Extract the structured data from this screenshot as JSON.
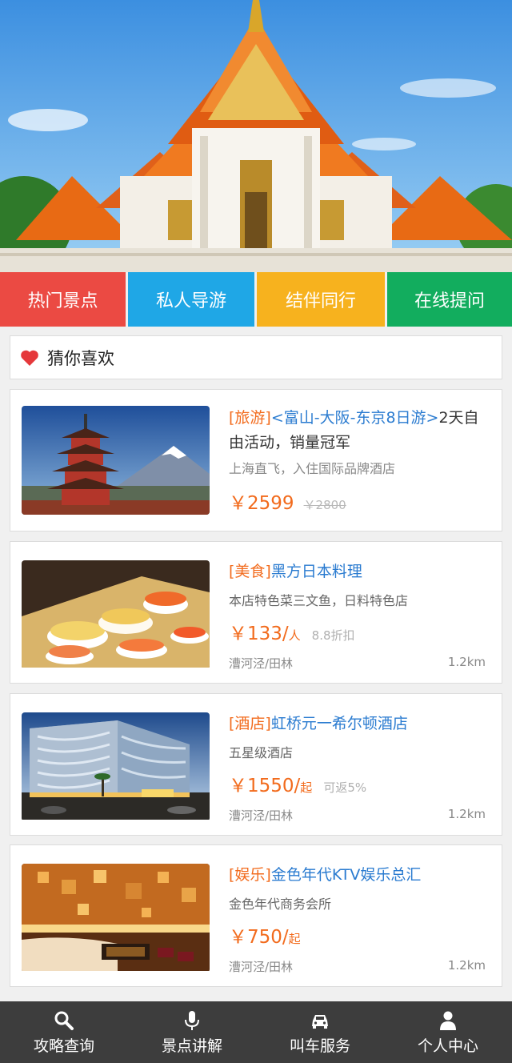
{
  "quick_nav": [
    {
      "label": "热门景点",
      "color": "#eb4a43"
    },
    {
      "label": "私人导游",
      "color": "#1fa7e6"
    },
    {
      "label": "结伴同行",
      "color": "#f7b21e"
    },
    {
      "label": "在线提问",
      "color": "#12ad5e"
    }
  ],
  "section": {
    "title": "猜你喜欢",
    "icon": "heart-icon"
  },
  "items": [
    {
      "tag": "[旅游]",
      "name": "<富山-大阪-东京8日游>",
      "name_suffix": "2天自由活动，销量冠军",
      "subtitle": "上海直飞，入住国际品牌酒店",
      "price": "￥2599",
      "old_price": "￥2800",
      "image": "mount-fuji-pagoda"
    },
    {
      "tag": "[美食]",
      "name": "黑方日本料理",
      "subtitle": "本店特色菜三文鱼，日料特色店",
      "price": "￥133/",
      "unit": "人",
      "extra": "8.8折扣",
      "location": "漕河泾/田林",
      "distance": "1.2km",
      "image": "sushi-platter"
    },
    {
      "tag": "[酒店]",
      "name": "虹桥元一希尔顿酒店",
      "subtitle": "五星级酒店",
      "price": "￥1550/",
      "unit": "起",
      "extra": "可返5%",
      "location": "漕河泾/田林",
      "distance": "1.2km",
      "image": "hotel-building"
    },
    {
      "tag": "[娱乐]",
      "name": "金色年代KTV娱乐总汇",
      "subtitle": "金色年代商务会所",
      "price": "￥750/",
      "unit": "起",
      "location": "漕河泾/田林",
      "distance": "1.2km",
      "image": "ktv-room"
    }
  ],
  "bottom_tabs": [
    {
      "label": "攻略查询",
      "icon": "search-icon"
    },
    {
      "label": "景点讲解",
      "icon": "microphone-icon"
    },
    {
      "label": "叫车服务",
      "icon": "car-icon"
    },
    {
      "label": "个人中心",
      "icon": "person-icon"
    }
  ],
  "colors": {
    "accent_orange": "#f26b1d",
    "link_blue": "#2a7bd0",
    "bottom_bar": "#3d3d3d"
  }
}
